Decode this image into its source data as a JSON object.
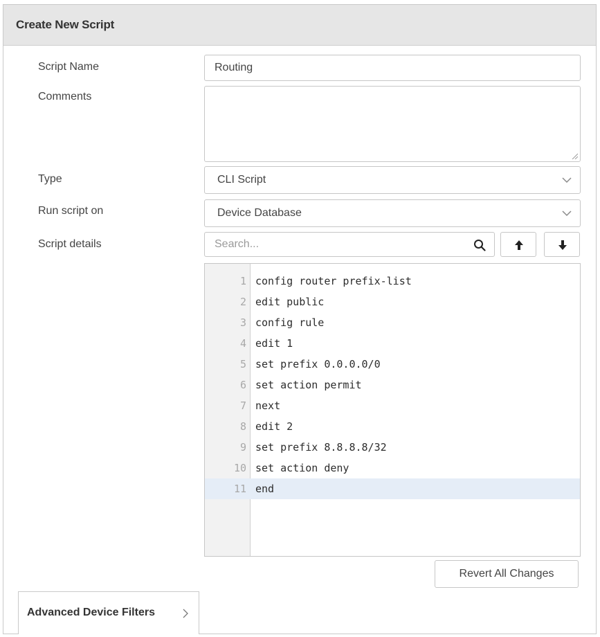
{
  "dialog": {
    "title": "Create New Script"
  },
  "form": {
    "script_name": {
      "label": "Script Name",
      "value": "Routing"
    },
    "comments": {
      "label": "Comments",
      "value": ""
    },
    "type": {
      "label": "Type",
      "selected": "CLI Script",
      "icon": "chevron-down-icon"
    },
    "run_on": {
      "label": "Run script on",
      "selected": "Device Database",
      "icon": "chevron-down-icon"
    },
    "script_details": {
      "label": "Script details",
      "search_placeholder": "Search...",
      "search_icon": "search-icon",
      "prev_icon": "arrow-up-icon",
      "next_icon": "arrow-down-icon"
    }
  },
  "editor": {
    "lines": [
      {
        "num": "1",
        "text": "config router prefix-list"
      },
      {
        "num": "2",
        "text": "edit public"
      },
      {
        "num": "3",
        "text": "config rule"
      },
      {
        "num": "4",
        "text": "edit 1"
      },
      {
        "num": "5",
        "text": "set prefix 0.0.0.0/0"
      },
      {
        "num": "6",
        "text": "set action permit"
      },
      {
        "num": "7",
        "text": "next"
      },
      {
        "num": "8",
        "text": "edit 2"
      },
      {
        "num": "9",
        "text": "set prefix 8.8.8.8/32"
      },
      {
        "num": "10",
        "text": "set action deny"
      },
      {
        "num": "11",
        "text": "end"
      }
    ],
    "active_line": "11"
  },
  "actions": {
    "revert_label": "Revert All Changes"
  },
  "advanced": {
    "label": "Advanced Device Filters",
    "icon": "chevron-right-icon"
  },
  "colors": {
    "header_bg": "#e6e6e6",
    "active_line_bg": "#e5edf7",
    "gutter_bg": "#f2f2f2"
  }
}
